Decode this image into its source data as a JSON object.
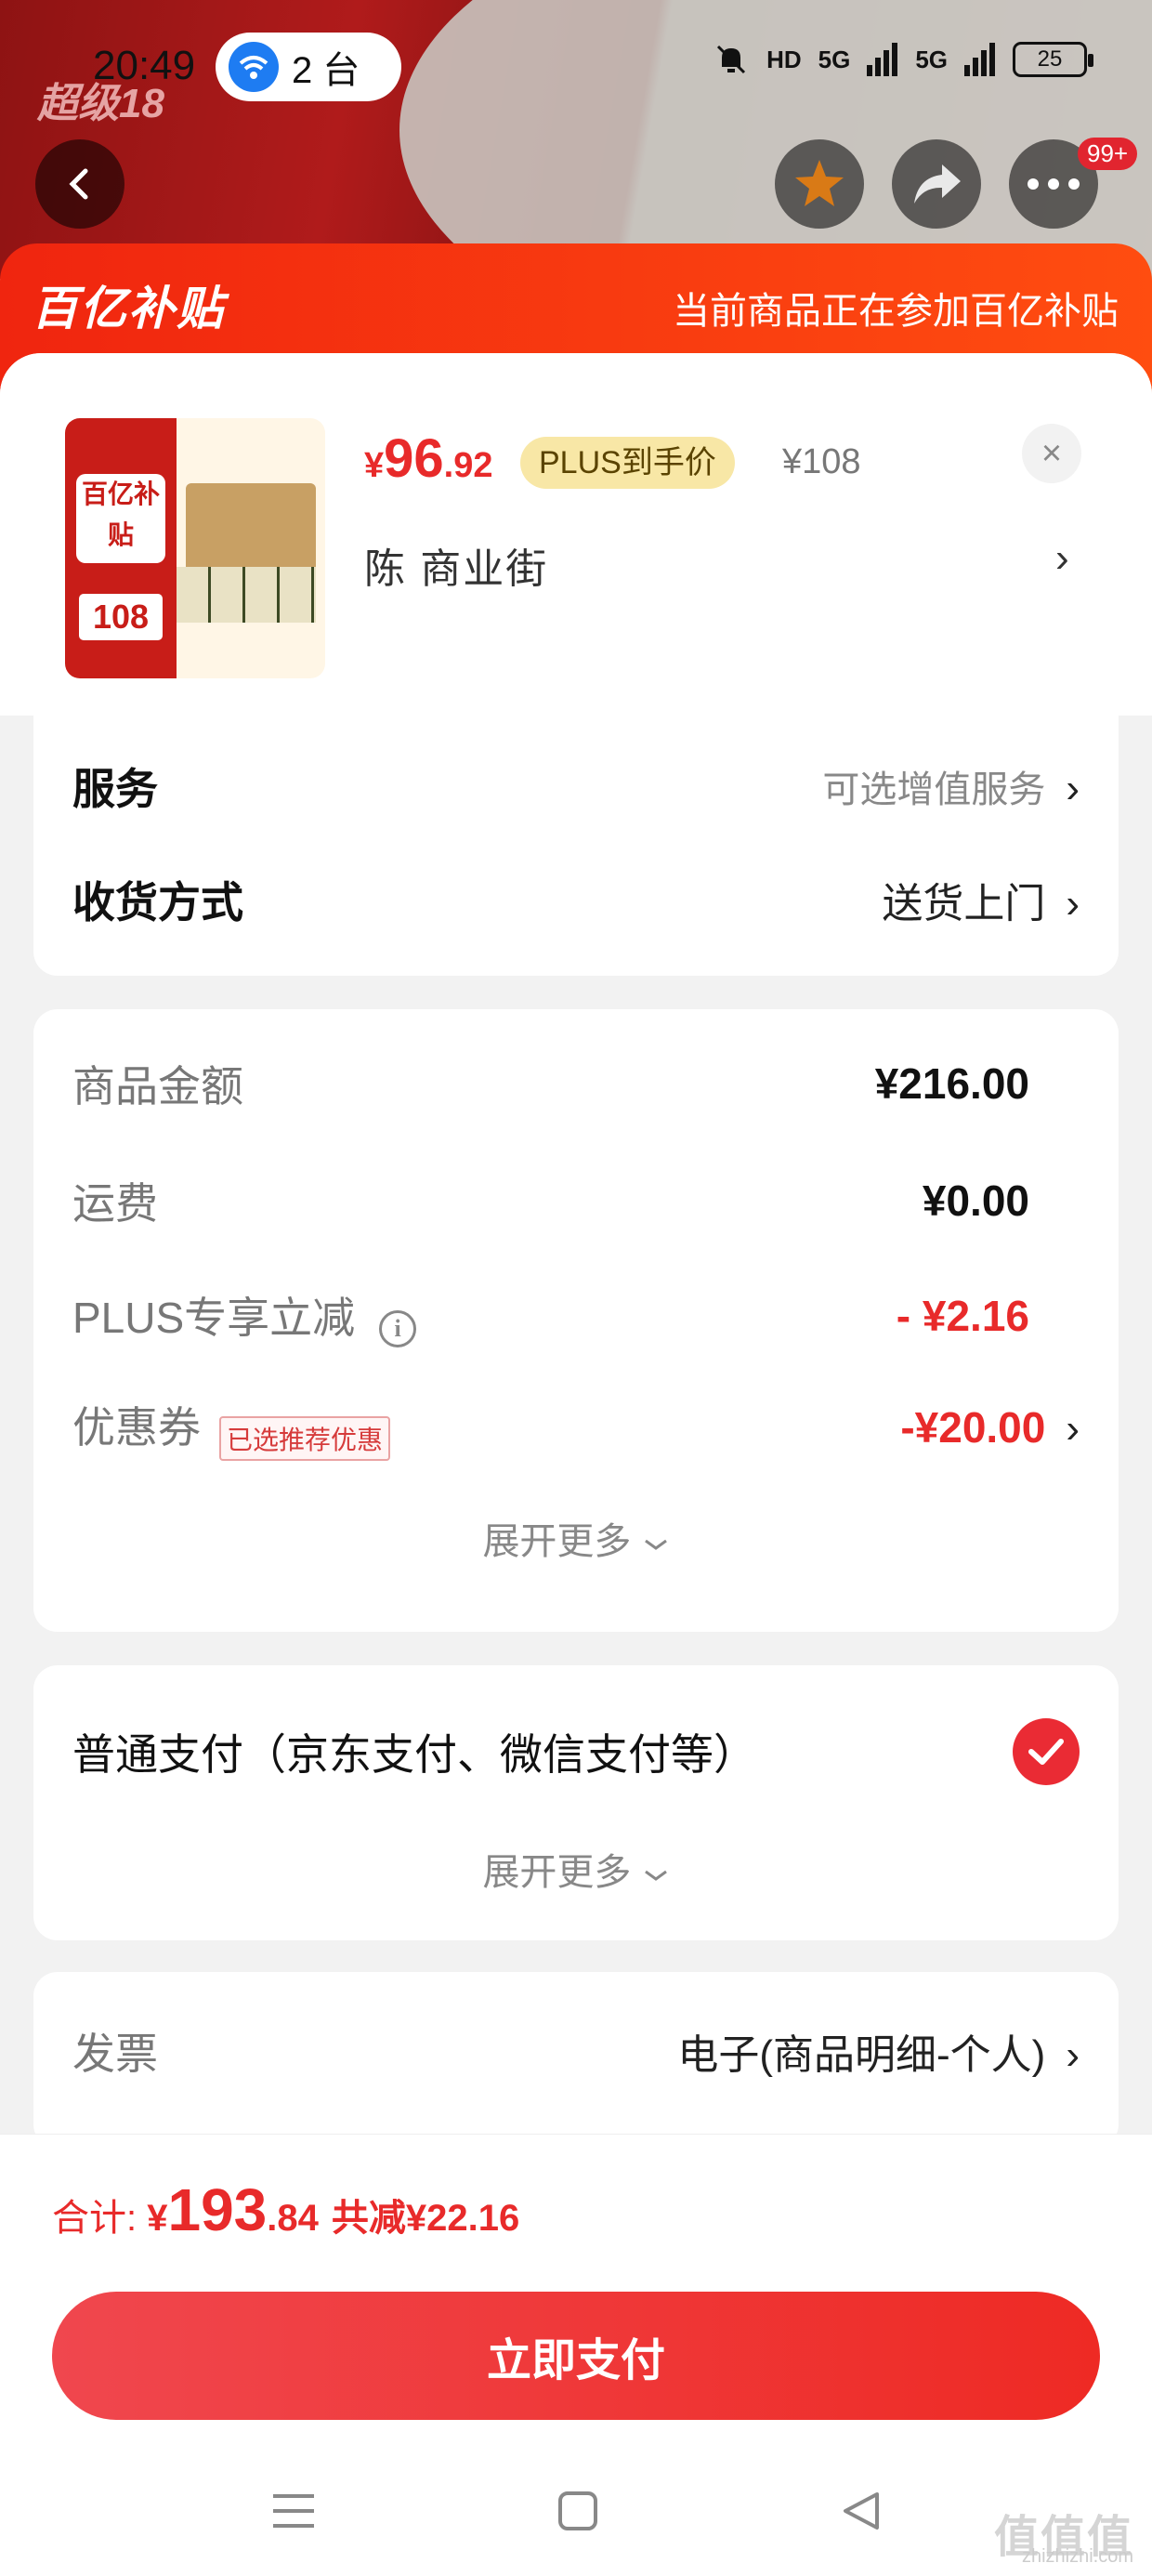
{
  "status_bar": {
    "time": "20:49",
    "hotspot_count": "2 台",
    "network_1": "HD",
    "network_2": "5G",
    "network_3": "5G",
    "battery": "25"
  },
  "header": {
    "brand_text": "超级18",
    "more_badge": "99+"
  },
  "banner": {
    "logo": "百亿补贴",
    "notice": "当前商品正在参加百亿补贴"
  },
  "product": {
    "thumb_sticker": "百亿补贴",
    "thumb_price": "108",
    "price_symbol": "¥",
    "price_int": "96",
    "price_dec": ".92",
    "plus_tag": "PLUS到手价",
    "original_price": "¥108",
    "close": "×",
    "address": "陈  商业街"
  },
  "options": {
    "service_label": "服务",
    "service_value": "可选增值服务",
    "delivery_label": "收货方式",
    "delivery_value": "送货上门"
  },
  "amounts": {
    "goods_label": "商品金额",
    "goods_value": "¥216.00",
    "shipping_label": "运费",
    "shipping_value": "¥0.00",
    "plus_label": "PLUS专享立减",
    "plus_value": "- ¥2.16",
    "coupon_label": "优惠券",
    "coupon_tag": "已选推荐优惠",
    "coupon_value": "-¥20.00",
    "expand": "展开更多"
  },
  "payment": {
    "method": "普通支付（京东支付、微信支付等）",
    "expand": "展开更多"
  },
  "invoice": {
    "label": "发票",
    "value": "电子(商品明细-个人)"
  },
  "total": {
    "label": "合计: ",
    "symbol": "¥",
    "int": "193",
    "dec": ".84",
    "saved": "共减¥22.16"
  },
  "pay_button": "立即支付",
  "watermark": {
    "big": "值值值",
    "small": "zhizhizhi.com"
  },
  "colors": {
    "accent_red": "#e82a2a",
    "banner_orange": "#ff4d10",
    "plus_gold": "#f8e7a6"
  }
}
